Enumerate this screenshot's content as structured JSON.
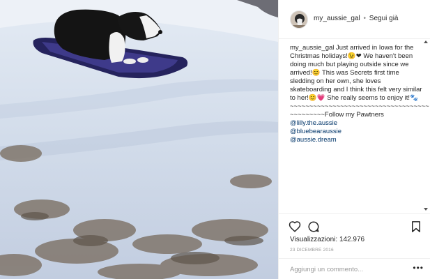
{
  "post": {
    "username": "my_aussie_gal",
    "separator": "•",
    "follow_status": "Segui già",
    "caption": {
      "username": "my_aussie_gal",
      "text": "Just arrived in Iowa for the Christmas holidays!😉❤ We haven't been doing much but playing outside since we arrived!😊 This was Secrets first time sledding on her own, she loves skateboarding and I think this felt very similar to her!😊💗 She really seems to enjoy it!🐾",
      "divider": "~~~~~~~~~~~~~~~~~~~~~~~~~~~~~~~~~~~~",
      "follow_line": "~~~~~~~~~Follow my Pawtners",
      "mentions": [
        "@lilly.the.aussie",
        "@bluebearaussie",
        "@aussie.dream"
      ]
    },
    "views": "Visualizzazioni: 142.976",
    "date": "23 DICEMBRE 2016",
    "comment_placeholder": "Aggiungi un commento...",
    "more": "•••"
  },
  "icons": {
    "like": "heart-icon",
    "comment": "comment-icon",
    "save": "bookmark-icon",
    "scroll_up": "scroll-up-arrow",
    "scroll_down": "scroll-down-arrow"
  },
  "colors": {
    "text": "#262626",
    "link": "#003569",
    "muted": "#999999",
    "border": "#efefef"
  }
}
